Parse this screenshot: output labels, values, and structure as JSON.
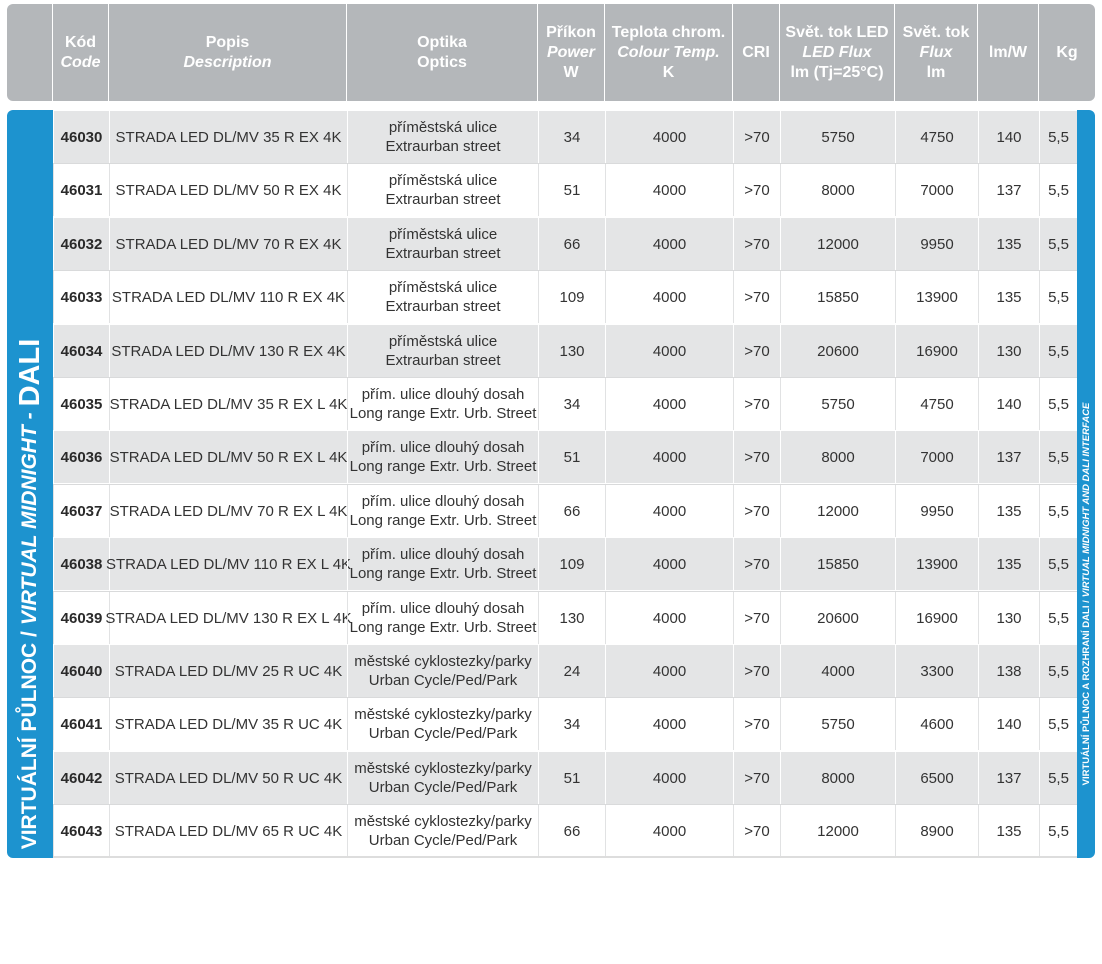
{
  "header": {
    "code": [
      "Kód",
      "Code"
    ],
    "desc": [
      "Popis",
      "Description"
    ],
    "optics": [
      "Optika",
      "Optics"
    ],
    "power": [
      "Příkon",
      "Power",
      "W"
    ],
    "temp": [
      "Teplota chrom.",
      "Colour Temp.",
      "K"
    ],
    "cri": [
      "CRI"
    ],
    "flux_led": [
      "Svět. tok LED",
      "LED Flux",
      "lm (Tj=25°C)"
    ],
    "flux": [
      "Svět. tok",
      "Flux",
      "lm"
    ],
    "lmw": [
      "lm/W"
    ],
    "kg": [
      "Kg"
    ]
  },
  "sidebar": {
    "label_plain": "VIRTUÁLNÍ PŮLNOC /",
    "label_italic": "VIRTUAL MIDNIGHT -",
    "label_big": "DALI"
  },
  "rightbar": {
    "label_plain": "VIRTUÁLNÍ PŮLNOC A ROZHRANÍ DALI /",
    "label_italic": "VIRTUAL MIDNIGHT AND DALI INTERFACE"
  },
  "rows": [
    {
      "code": "46030",
      "desc": "STRADA LED DL/MV 35 R EX 4K",
      "optics1": "příměstská ulice",
      "optics2": "Extraurban street",
      "power": "34",
      "temp": "4000",
      "cri": ">70",
      "flux_led": "5750",
      "flux": "4750",
      "lmw": "140",
      "kg": "5,5"
    },
    {
      "code": "46031",
      "desc": "STRADA LED DL/MV 50 R EX 4K",
      "optics1": "příměstská ulice",
      "optics2": "Extraurban street",
      "power": "51",
      "temp": "4000",
      "cri": ">70",
      "flux_led": "8000",
      "flux": "7000",
      "lmw": "137",
      "kg": "5,5"
    },
    {
      "code": "46032",
      "desc": "STRADA LED DL/MV 70 R EX 4K",
      "optics1": "příměstská ulice",
      "optics2": "Extraurban street",
      "power": "66",
      "temp": "4000",
      "cri": ">70",
      "flux_led": "12000",
      "flux": "9950",
      "lmw": "135",
      "kg": "5,5"
    },
    {
      "code": "46033",
      "desc": "STRADA LED DL/MV 110 R EX 4K",
      "optics1": "příměstská ulice",
      "optics2": "Extraurban street",
      "power": "109",
      "temp": "4000",
      "cri": ">70",
      "flux_led": "15850",
      "flux": "13900",
      "lmw": "135",
      "kg": "5,5"
    },
    {
      "code": "46034",
      "desc": "STRADA LED DL/MV 130 R EX 4K",
      "optics1": "příměstská ulice",
      "optics2": "Extraurban street",
      "power": "130",
      "temp": "4000",
      "cri": ">70",
      "flux_led": "20600",
      "flux": "16900",
      "lmw": "130",
      "kg": "5,5"
    },
    {
      "code": "46035",
      "desc": "STRADA LED DL/MV 35 R EX L 4K",
      "optics1": "přím. ulice dlouhý dosah",
      "optics2": "Long range Extr. Urb. Street",
      "power": "34",
      "temp": "4000",
      "cri": ">70",
      "flux_led": "5750",
      "flux": "4750",
      "lmw": "140",
      "kg": "5,5"
    },
    {
      "code": "46036",
      "desc": "STRADA LED DL/MV 50 R EX L 4K",
      "optics1": "přím. ulice dlouhý dosah",
      "optics2": "Long range Extr. Urb. Street",
      "power": "51",
      "temp": "4000",
      "cri": ">70",
      "flux_led": "8000",
      "flux": "7000",
      "lmw": "137",
      "kg": "5,5"
    },
    {
      "code": "46037",
      "desc": "STRADA LED DL/MV 70 R EX L 4K",
      "optics1": "přím. ulice dlouhý dosah",
      "optics2": "Long range Extr. Urb. Street",
      "power": "66",
      "temp": "4000",
      "cri": ">70",
      "flux_led": "12000",
      "flux": "9950",
      "lmw": "135",
      "kg": "5,5"
    },
    {
      "code": "46038",
      "desc": "STRADA LED DL/MV 110 R EX L 4K",
      "optics1": "přím. ulice dlouhý dosah",
      "optics2": "Long range Extr. Urb. Street",
      "power": "109",
      "temp": "4000",
      "cri": ">70",
      "flux_led": "15850",
      "flux": "13900",
      "lmw": "135",
      "kg": "5,5"
    },
    {
      "code": "46039",
      "desc": "STRADA LED DL/MV 130 R EX L 4K",
      "optics1": "přím. ulice dlouhý dosah",
      "optics2": "Long range Extr. Urb. Street",
      "power": "130",
      "temp": "4000",
      "cri": ">70",
      "flux_led": "20600",
      "flux": "16900",
      "lmw": "130",
      "kg": "5,5"
    },
    {
      "code": "46040",
      "desc": "STRADA LED DL/MV 25 R UC 4K",
      "optics1": "městské cyklostezky/parky",
      "optics2": "Urban Cycle/Ped/Park",
      "power": "24",
      "temp": "4000",
      "cri": ">70",
      "flux_led": "4000",
      "flux": "3300",
      "lmw": "138",
      "kg": "5,5"
    },
    {
      "code": "46041",
      "desc": "STRADA LED DL/MV 35 R UC 4K",
      "optics1": "městské cyklostezky/parky",
      "optics2": "Urban Cycle/Ped/Park",
      "power": "34",
      "temp": "4000",
      "cri": ">70",
      "flux_led": "5750",
      "flux": "4600",
      "lmw": "140",
      "kg": "5,5"
    },
    {
      "code": "46042",
      "desc": "STRADA LED DL/MV 50 R UC 4K",
      "optics1": "městské cyklostezky/parky",
      "optics2": "Urban Cycle/Ped/Park",
      "power": "51",
      "temp": "4000",
      "cri": ">70",
      "flux_led": "8000",
      "flux": "6500",
      "lmw": "137",
      "kg": "5,5"
    },
    {
      "code": "46043",
      "desc": "STRADA LED DL/MV 65 R UC 4K",
      "optics1": "městské cyklostezky/parky",
      "optics2": "Urban Cycle/Ped/Park",
      "power": "66",
      "temp": "4000",
      "cri": ">70",
      "flux_led": "12000",
      "flux": "8900",
      "lmw": "135",
      "kg": "5,5"
    }
  ]
}
